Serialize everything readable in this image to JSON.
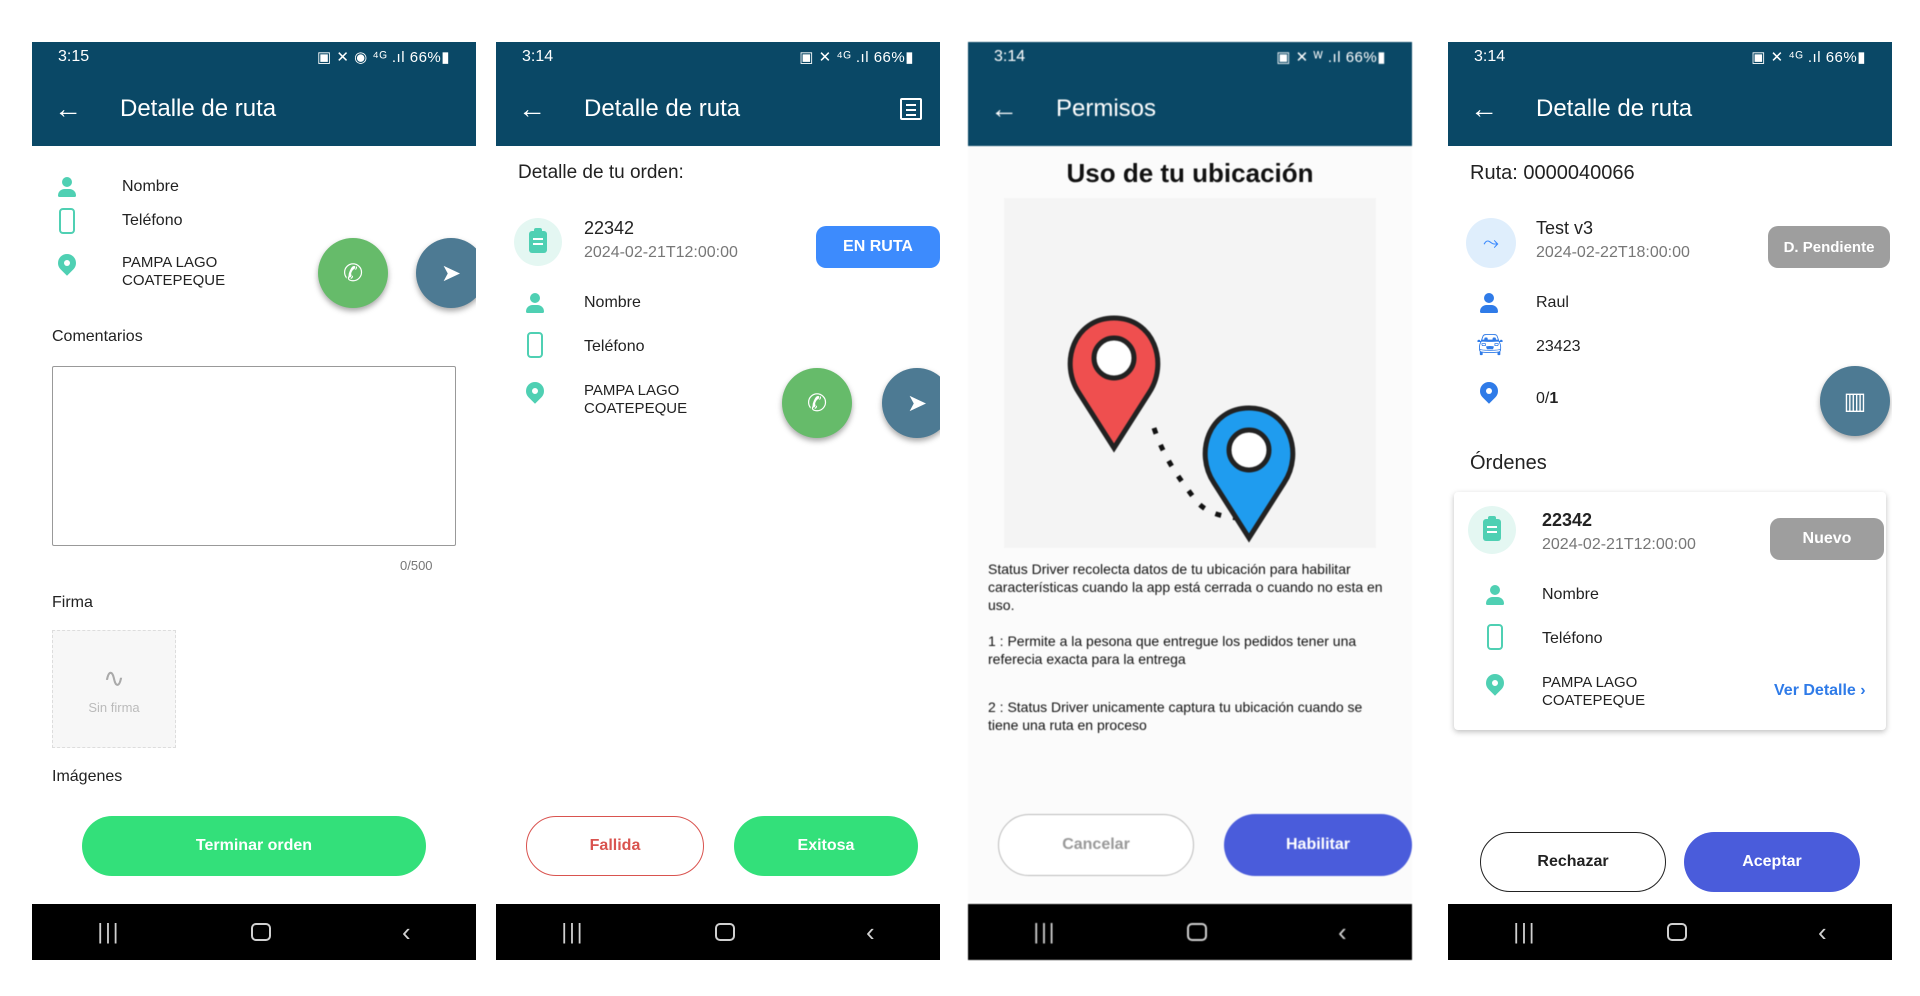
{
  "screen1": {
    "status_time": "3:15",
    "status_right": "▣ ✕ ◉ ⁴ᴳ .ıl 66%▮",
    "title": "Detalle de ruta",
    "contact": {
      "name": "Nombre",
      "phone": "Teléfono",
      "address": "PAMPA LAGO\nCOATEPEQUE"
    },
    "comments_label": "Comentarios",
    "comments_value": "",
    "comments_counter": "0/500",
    "signature_label": "Firma",
    "signature_placeholder": "Sin firma",
    "images_label": "Imágenes",
    "finish_button": "Terminar orden"
  },
  "screen2": {
    "status_time": "3:14",
    "status_right": "▣ ✕ ⁴ᴳ .ıl 66%▮",
    "title": "Detalle de ruta",
    "section_label": "Detalle de tu orden:",
    "order_number": "22342",
    "order_date": "2024-02-21T12:00:00",
    "status_chip": "EN RUTA",
    "contact": {
      "name": "Nombre",
      "phone": "Teléfono",
      "address": "PAMPA LAGO\nCOATEPEQUE"
    },
    "failed_button": "Fallida",
    "success_button": "Exitosa"
  },
  "screen3": {
    "status_time": "3:14",
    "status_right": "▣ ✕ ᵂ .ıl 66%▮",
    "title": "Permisos",
    "heading": "Uso de tu ubicación",
    "paragraph1": "Status Driver recolecta datos de tu ubicación para habilitar características cuando la app está cerrada o cuando no esta en uso.",
    "paragraph2": "1 : Permite a la pesona que entregue los pedidos tener una referecia exacta para la entrega",
    "paragraph3": "2 : Status Driver unicamente captura tu ubicación cuando se tiene una ruta en proceso",
    "cancel_button": "Cancelar",
    "enable_button": "Habilitar"
  },
  "screen4": {
    "status_time": "3:14",
    "status_right": "▣ ✕ ⁴ᴳ .ıl 66%▮",
    "title": "Detalle de ruta",
    "route_label": "Ruta: 0000040066",
    "route_name": "Test v3",
    "route_date": "2024-02-22T18:00:00",
    "route_status": "D. Pendiente",
    "driver": "Raul",
    "vehicle": "23423",
    "progress_done": "0/",
    "progress_total": "1",
    "orders_label": "Órdenes",
    "order": {
      "number": "22342",
      "date": "2024-02-21T12:00:00",
      "status": "Nuevo",
      "name": "Nombre",
      "phone": "Teléfono",
      "address": "PAMPA LAGO\nCOATEPEQUE",
      "details_link": "Ver Detalle"
    },
    "reject_button": "Rechazar",
    "accept_button": "Aceptar"
  },
  "colors": {
    "appbar": "#0a4866",
    "teal_icon": "#4fd0b3",
    "green_button": "#33e07a",
    "blue_chip": "#3d8bfd",
    "gray_chip": "#9e9e9e",
    "indigo_button": "#4a5cdb",
    "red_outline": "#d9534f"
  }
}
